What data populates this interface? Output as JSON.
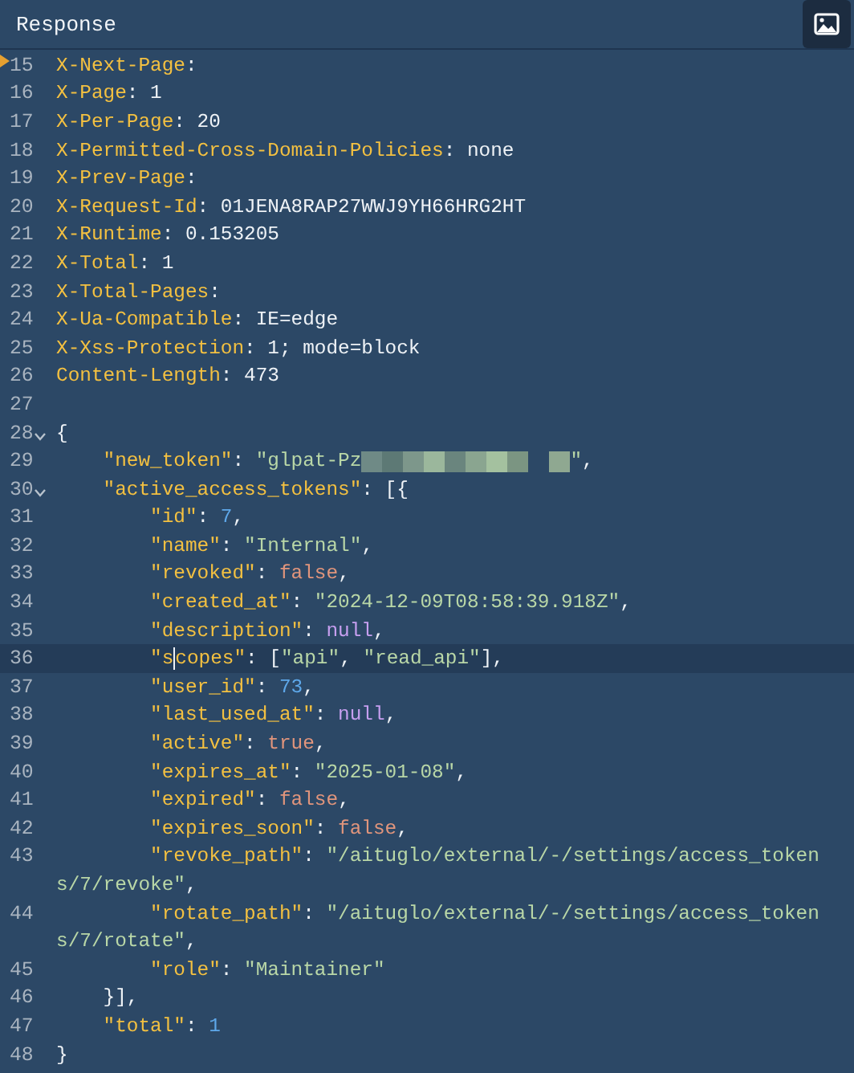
{
  "panel": {
    "title": "Response"
  },
  "lines": [
    {
      "num": "15",
      "marked": true,
      "tokens": [
        {
          "kind": "key",
          "text": "X-Next-Page"
        },
        {
          "kind": "punct",
          "text": ":"
        }
      ]
    },
    {
      "num": "16",
      "tokens": [
        {
          "kind": "key",
          "text": "X-Page"
        },
        {
          "kind": "punct",
          "text": ": 1"
        }
      ]
    },
    {
      "num": "17",
      "tokens": [
        {
          "kind": "key",
          "text": "X-Per-Page"
        },
        {
          "kind": "punct",
          "text": ": 20"
        }
      ]
    },
    {
      "num": "18",
      "tokens": [
        {
          "kind": "key",
          "text": "X-Permitted-Cross-Domain-Policies"
        },
        {
          "kind": "punct",
          "text": ": none"
        }
      ]
    },
    {
      "num": "19",
      "tokens": [
        {
          "kind": "key",
          "text": "X-Prev-Page"
        },
        {
          "kind": "punct",
          "text": ":"
        }
      ]
    },
    {
      "num": "20",
      "tokens": [
        {
          "kind": "key",
          "text": "X-Request-Id"
        },
        {
          "kind": "punct",
          "text": ": 01JENA8RAP27WWJ9YH66HRG2HT"
        }
      ]
    },
    {
      "num": "21",
      "tokens": [
        {
          "kind": "key",
          "text": "X-Runtime"
        },
        {
          "kind": "punct",
          "text": ": 0.153205"
        }
      ]
    },
    {
      "num": "22",
      "tokens": [
        {
          "kind": "key",
          "text": "X-Total"
        },
        {
          "kind": "punct",
          "text": ": 1"
        }
      ]
    },
    {
      "num": "23",
      "tokens": [
        {
          "kind": "key",
          "text": "X-Total-Pages"
        },
        {
          "kind": "punct",
          "text": ":"
        }
      ]
    },
    {
      "num": "24",
      "tokens": [
        {
          "kind": "key",
          "text": "X-Ua-Compatible"
        },
        {
          "kind": "punct",
          "text": ": IE=edge"
        }
      ]
    },
    {
      "num": "25",
      "tokens": [
        {
          "kind": "key",
          "text": "X-Xss-Protection"
        },
        {
          "kind": "punct",
          "text": ": 1; mode=block"
        }
      ]
    },
    {
      "num": "26",
      "tokens": [
        {
          "kind": "key",
          "text": "Content-Length"
        },
        {
          "kind": "punct",
          "text": ": 473"
        }
      ]
    },
    {
      "num": "27"
    },
    {
      "num": "28",
      "expanded": true,
      "tokens": [
        {
          "kind": "punct",
          "text": "{"
        }
      ]
    },
    {
      "num": "29",
      "tokens": [
        {
          "kind": "key",
          "text": "    \"new_token\""
        },
        {
          "kind": "punct",
          "text": ": "
        },
        {
          "kind": "string",
          "text": "\"glpat-Pz"
        },
        {
          "kind": "redacted"
        },
        {
          "kind": "string",
          "text": "\""
        },
        {
          "kind": "punct",
          "text": ","
        }
      ]
    },
    {
      "num": "30",
      "expanded": true,
      "tokens": [
        {
          "kind": "key",
          "text": "    \"active_access_tokens\""
        },
        {
          "kind": "punct",
          "text": ": [{"
        }
      ]
    },
    {
      "num": "31",
      "tokens": [
        {
          "kind": "key",
          "text": "        \"id\""
        },
        {
          "kind": "punct",
          "text": ": "
        },
        {
          "kind": "number",
          "text": "7"
        },
        {
          "kind": "punct",
          "text": ","
        }
      ]
    },
    {
      "num": "32",
      "tokens": [
        {
          "kind": "key",
          "text": "        \"name\""
        },
        {
          "kind": "punct",
          "text": ": "
        },
        {
          "kind": "string",
          "text": "\"Internal\""
        },
        {
          "kind": "punct",
          "text": ","
        }
      ]
    },
    {
      "num": "33",
      "tokens": [
        {
          "kind": "key",
          "text": "        \"revoked\""
        },
        {
          "kind": "punct",
          "text": ": "
        },
        {
          "kind": "bool",
          "text": "false"
        },
        {
          "kind": "punct",
          "text": ","
        }
      ]
    },
    {
      "num": "34",
      "tokens": [
        {
          "kind": "key",
          "text": "        \"created_at\""
        },
        {
          "kind": "punct",
          "text": ": "
        },
        {
          "kind": "string",
          "text": "\"2024-12-09T08:58:39.918Z\""
        },
        {
          "kind": "punct",
          "text": ","
        }
      ]
    },
    {
      "num": "35",
      "tokens": [
        {
          "kind": "key",
          "text": "        \"description\""
        },
        {
          "kind": "punct",
          "text": ": "
        },
        {
          "kind": "null",
          "text": "null"
        },
        {
          "kind": "punct",
          "text": ","
        }
      ]
    },
    {
      "num": "36",
      "current": true,
      "tokens": [
        {
          "kind": "key",
          "text": "        \"s"
        },
        {
          "kind": "caret"
        },
        {
          "kind": "key",
          "text": "copes\""
        },
        {
          "kind": "punct",
          "text": ": ["
        },
        {
          "kind": "string",
          "text": "\"api\""
        },
        {
          "kind": "punct",
          "text": ", "
        },
        {
          "kind": "string",
          "text": "\"read_api\""
        },
        {
          "kind": "punct",
          "text": "],"
        }
      ]
    },
    {
      "num": "37",
      "tokens": [
        {
          "kind": "key",
          "text": "        \"user_id\""
        },
        {
          "kind": "punct",
          "text": ": "
        },
        {
          "kind": "number",
          "text": "73"
        },
        {
          "kind": "punct",
          "text": ","
        }
      ]
    },
    {
      "num": "38",
      "tokens": [
        {
          "kind": "key",
          "text": "        \"last_used_at\""
        },
        {
          "kind": "punct",
          "text": ": "
        },
        {
          "kind": "null",
          "text": "null"
        },
        {
          "kind": "punct",
          "text": ","
        }
      ]
    },
    {
      "num": "39",
      "tokens": [
        {
          "kind": "key",
          "text": "        \"active\""
        },
        {
          "kind": "punct",
          "text": ": "
        },
        {
          "kind": "bool",
          "text": "true"
        },
        {
          "kind": "punct",
          "text": ","
        }
      ]
    },
    {
      "num": "40",
      "tokens": [
        {
          "kind": "key",
          "text": "        \"expires_at\""
        },
        {
          "kind": "punct",
          "text": ": "
        },
        {
          "kind": "string",
          "text": "\"2025-01-08\""
        },
        {
          "kind": "punct",
          "text": ","
        }
      ]
    },
    {
      "num": "41",
      "tokens": [
        {
          "kind": "key",
          "text": "        \"expired\""
        },
        {
          "kind": "punct",
          "text": ": "
        },
        {
          "kind": "bool",
          "text": "false"
        },
        {
          "kind": "punct",
          "text": ","
        }
      ]
    },
    {
      "num": "42",
      "tokens": [
        {
          "kind": "key",
          "text": "        \"expires_soon\""
        },
        {
          "kind": "punct",
          "text": ": "
        },
        {
          "kind": "bool",
          "text": "false"
        },
        {
          "kind": "punct",
          "text": ","
        }
      ]
    },
    {
      "num": "43",
      "tokens": [
        {
          "kind": "key",
          "text": "        \"revoke_path\""
        },
        {
          "kind": "punct",
          "text": ": "
        },
        {
          "kind": "string",
          "text": "\"/aituglo/external/-/settings/access_token"
        }
      ],
      "continuation": [
        {
          "kind": "string",
          "text": "s/7/revoke\""
        },
        {
          "kind": "punct",
          "text": ","
        }
      ]
    },
    {
      "num": "44",
      "tokens": [
        {
          "kind": "key",
          "text": "        \"rotate_path\""
        },
        {
          "kind": "punct",
          "text": ": "
        },
        {
          "kind": "string",
          "text": "\"/aituglo/external/-/settings/access_token"
        }
      ],
      "continuation": [
        {
          "kind": "string",
          "text": "s/7/rotate\""
        },
        {
          "kind": "punct",
          "text": ","
        }
      ]
    },
    {
      "num": "45",
      "tokens": [
        {
          "kind": "key",
          "text": "        \"role\""
        },
        {
          "kind": "punct",
          "text": ": "
        },
        {
          "kind": "string",
          "text": "\"Maintainer\""
        }
      ]
    },
    {
      "num": "46",
      "tokens": [
        {
          "kind": "punct",
          "text": "    }],"
        }
      ]
    },
    {
      "num": "47",
      "tokens": [
        {
          "kind": "key",
          "text": "    \"total\""
        },
        {
          "kind": "punct",
          "text": ": "
        },
        {
          "kind": "number",
          "text": "1"
        }
      ]
    },
    {
      "num": "48",
      "tokens": [
        {
          "kind": "punct",
          "text": "}"
        }
      ]
    }
  ]
}
